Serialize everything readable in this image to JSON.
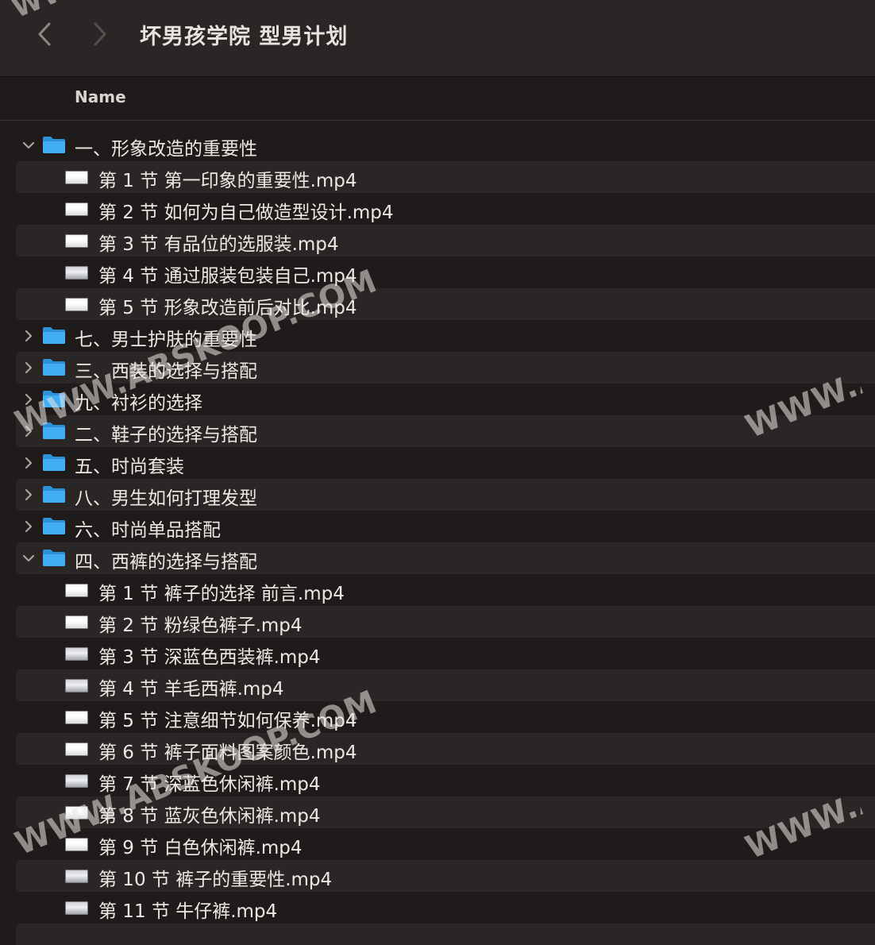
{
  "window": {
    "title": "坏男孩学院 型男计划"
  },
  "header": {
    "name_column": "Name"
  },
  "icons": {
    "back": "chevron-left-icon",
    "forward": "chevron-right-icon",
    "folder": "folder-icon",
    "video": "video-file-icon"
  },
  "colors": {
    "folder_blue": "#3ba6ef",
    "background": "#1f1b1a",
    "row_alt": "#2a2625"
  },
  "items": [
    {
      "type": "folder",
      "expanded": true,
      "label": "一、形象改造的重要性"
    },
    {
      "type": "file",
      "label": "第 1 节 第一印象的重要性.mp4"
    },
    {
      "type": "file",
      "label": "第 2 节 如何为自己做造型设计.mp4"
    },
    {
      "type": "file",
      "label": "第 3 节 有品位的选服装.mp4"
    },
    {
      "type": "file",
      "label": "第 4 节 通过服装包装自己.mp4"
    },
    {
      "type": "file",
      "label": "第 5 节 形象改造前后对比.mp4"
    },
    {
      "type": "folder",
      "expanded": false,
      "label": "七、男士护肤的重要性"
    },
    {
      "type": "folder",
      "expanded": false,
      "label": "三、西装的选择与搭配"
    },
    {
      "type": "folder",
      "expanded": false,
      "label": "九、衬衫的选择"
    },
    {
      "type": "folder",
      "expanded": false,
      "label": "二、鞋子的选择与搭配"
    },
    {
      "type": "folder",
      "expanded": false,
      "label": "五、时尚套装"
    },
    {
      "type": "folder",
      "expanded": false,
      "label": "八、男生如何打理发型"
    },
    {
      "type": "folder",
      "expanded": false,
      "label": "六、时尚单品搭配"
    },
    {
      "type": "folder",
      "expanded": true,
      "label": "四、西裤的选择与搭配"
    },
    {
      "type": "file",
      "label": "第 1 节 裤子的选择 前言.mp4"
    },
    {
      "type": "file",
      "label": "第 2 节 粉绿色裤子.mp4"
    },
    {
      "type": "file",
      "label": "第 3 节 深蓝色西装裤.mp4"
    },
    {
      "type": "file",
      "label": "第 4 节 羊毛西裤.mp4"
    },
    {
      "type": "file",
      "label": "第 5 节 注意细节如何保养.mp4"
    },
    {
      "type": "file",
      "label": "第 6 节 裤子面料图案颜色.mp4"
    },
    {
      "type": "file",
      "label": "第 7 节 深蓝色休闲裤.mp4"
    },
    {
      "type": "file",
      "label": "第 8 节 蓝灰色休闲裤.mp4"
    },
    {
      "type": "file",
      "label": "第 9 节 白色休闲裤.mp4"
    },
    {
      "type": "file",
      "label": "第 10 节 裤子的重要性.mp4"
    },
    {
      "type": "file",
      "label": "第 11 节 牛仔裤.mp4"
    }
  ],
  "watermarks": [
    "WWW.ABSKOOP.COM",
    "WWW.A",
    "WWW.ABSKOOP.COM",
    "WWW.A",
    "WWW"
  ]
}
